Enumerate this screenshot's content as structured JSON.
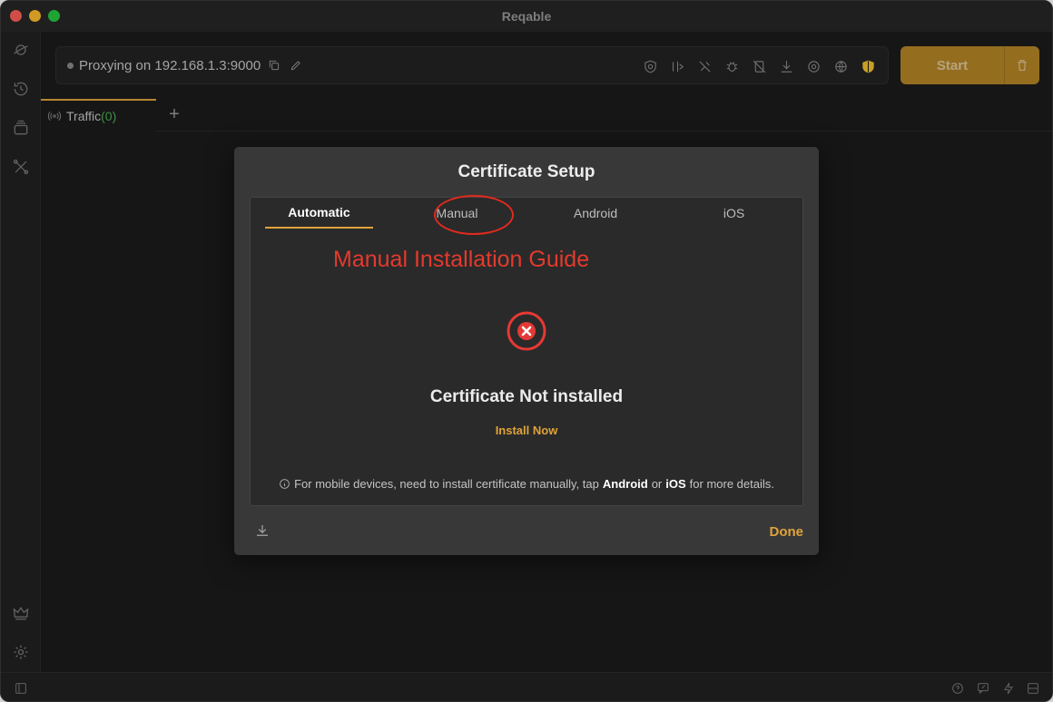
{
  "window": {
    "title": "Reqable"
  },
  "proxy": {
    "status_text": "Proxying on 192.168.1.3:9000"
  },
  "toolbar": {
    "start_label": "Start"
  },
  "tabs": [
    {
      "label": "Traffic",
      "count": "(0)"
    }
  ],
  "dialog": {
    "title": "Certificate Setup",
    "tabs": [
      "Automatic",
      "Manual",
      "Android",
      "iOS"
    ],
    "active_tab": "Automatic",
    "annotation": "Manual Installation Guide",
    "status": "Certificate Not installed",
    "install_link": "Install Now",
    "hint": {
      "prefix": "For mobile devices, need to install certificate manually, tap",
      "android": "Android",
      "or": "or",
      "ios": "iOS",
      "suffix": "for more details."
    },
    "done_label": "Done"
  },
  "colors": {
    "accent": "#e0a33a",
    "error": "#e53935",
    "annotation": "#e02a1f",
    "count": "#4caf50"
  }
}
